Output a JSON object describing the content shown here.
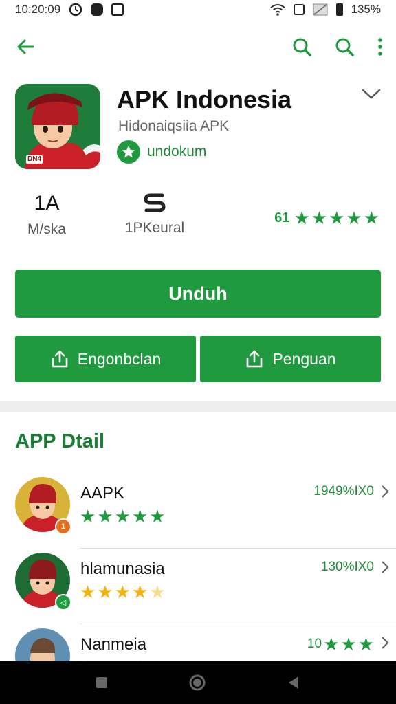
{
  "status_bar": {
    "time": "10:20:09",
    "battery": "135%"
  },
  "toolbar": {
    "back_icon": "arrow-left-icon",
    "search_icon": "search-icon",
    "search_icon_2": "search-icon",
    "menu_icon": "more-vert-icon"
  },
  "app": {
    "title": "APK Indonesia",
    "subtitle": "Hidonaiqsiia APK",
    "publisher": "undokum",
    "icon_tag": "DN4"
  },
  "stats": {
    "first_value": "1A",
    "first_label": "M/ska",
    "second_label": "1PKeural",
    "rating_prefix": "61",
    "rating_stars": 5
  },
  "buttons": {
    "install": "Unduh",
    "left": "Engonbclan",
    "right": "Penguan"
  },
  "section": {
    "title": "APP Dtail"
  },
  "list": [
    {
      "name": "AAPK",
      "meta": "1949%IX0",
      "stars": 5,
      "star_color": "green",
      "badge_label": "1",
      "badge_color": "#e86d1b"
    },
    {
      "name": "hlamunasia",
      "meta": "130%IX0",
      "stars": 4,
      "star_color": "gold",
      "badge_label": "◁",
      "badge_color": "#1f9a3e"
    },
    {
      "name": "Nanmeia",
      "meta": "10",
      "stars": 3,
      "star_color": "green",
      "badge_label": "",
      "badge_color": ""
    }
  ],
  "colors": {
    "accent": "#1f9a3e",
    "section_title": "#1a7d34",
    "star_gold": "#f3b10e"
  }
}
